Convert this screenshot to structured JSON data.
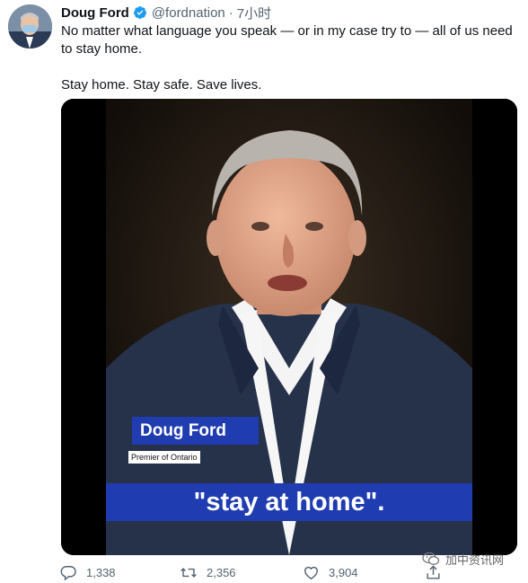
{
  "tweet": {
    "author_name": "Doug Ford",
    "handle": "@fordnation",
    "separator": "·",
    "time": "7小时",
    "text_line1": "No matter what language you speak — or in my case try to — all of us need to stay home.",
    "text_line2": "Stay home. Stay safe. Save lives."
  },
  "video": {
    "name_lower_third": "Doug Ford",
    "title_lower_third": "Premier of Ontario",
    "caption": "\"stay at home\"."
  },
  "actions": {
    "reply_count": "1,338",
    "retweet_count": "2,356",
    "like_count": "3,904"
  },
  "watermark": {
    "text": "加中资讯网"
  },
  "colors": {
    "verified": "#1d9bf0",
    "lower_third_bg": "#1f3cb0",
    "secondary_text": "#536471"
  },
  "icons": {
    "verified": "verified-badge-icon",
    "reply": "reply-icon",
    "retweet": "retweet-icon",
    "like": "heart-icon",
    "share": "share-icon"
  }
}
